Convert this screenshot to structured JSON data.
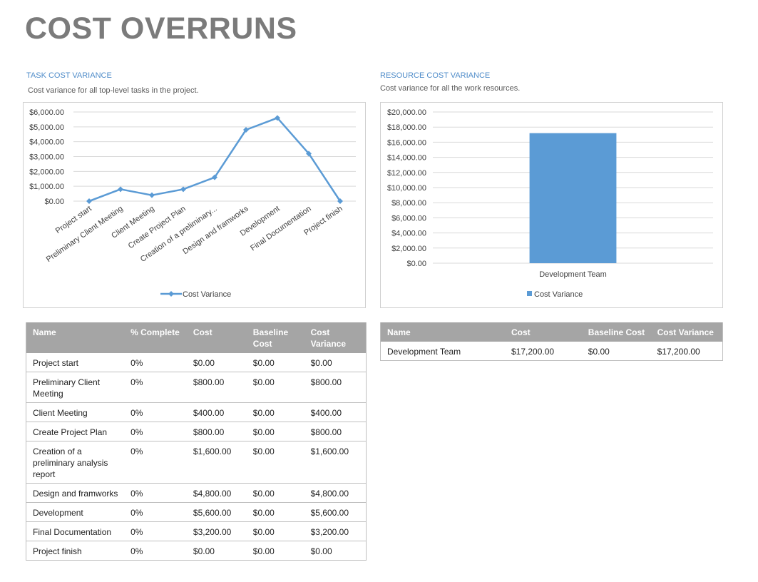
{
  "page": {
    "title": "COST OVERRUNS"
  },
  "task_section": {
    "title": "TASK COST VARIANCE",
    "subtitle": "Cost variance for all top-level tasks in the project."
  },
  "resource_section": {
    "title": "RESOURCE COST VARIANCE",
    "subtitle": "Cost variance for all the work resources."
  },
  "chart_data": [
    {
      "type": "line",
      "categories": [
        "Project start",
        "Preliminary Client Meeting",
        "Client Meeting",
        "Create Project Plan",
        "Creation of a preliminary...",
        "Design and framworks",
        "Development",
        "Final Documentation",
        "Project finish"
      ],
      "series": [
        {
          "name": "Cost Variance",
          "values": [
            0,
            800,
            400,
            800,
            1600,
            4800,
            5600,
            3200,
            0
          ],
          "color": "#5b9bd5"
        }
      ],
      "yticks": [
        "$0.00",
        "$1,000.00",
        "$2,000.00",
        "$3,000.00",
        "$4,000.00",
        "$5,000.00",
        "$6,000.00"
      ],
      "ylim": [
        0,
        6000
      ],
      "grid": true,
      "legend": "bottom"
    },
    {
      "type": "bar",
      "categories": [
        "Development Team"
      ],
      "series": [
        {
          "name": "Cost Variance",
          "values": [
            17200
          ],
          "color": "#5b9bd5"
        }
      ],
      "yticks": [
        "$0.00",
        "$2,000.00",
        "$4,000.00",
        "$6,000.00",
        "$8,000.00",
        "$10,000.00",
        "$12,000.00",
        "$14,000.00",
        "$16,000.00",
        "$18,000.00",
        "$20,000.00"
      ],
      "ylim": [
        0,
        20000
      ],
      "grid": true,
      "legend": "bottom"
    }
  ],
  "task_table": {
    "headers": [
      "Name",
      "% Complete",
      "Cost",
      "Baseline Cost",
      "Cost Variance"
    ],
    "rows": [
      [
        "Project start",
        "0%",
        "$0.00",
        "$0.00",
        "$0.00"
      ],
      [
        "Preliminary Client Meeting",
        "0%",
        "$800.00",
        "$0.00",
        "$800.00"
      ],
      [
        "Client Meeting",
        "0%",
        "$400.00",
        "$0.00",
        "$400.00"
      ],
      [
        "Create Project Plan",
        "0%",
        "$800.00",
        "$0.00",
        "$800.00"
      ],
      [
        "Creation of a preliminary analysis report",
        "0%",
        "$1,600.00",
        "$0.00",
        "$1,600.00"
      ],
      [
        "Design and framworks",
        "0%",
        "$4,800.00",
        "$0.00",
        "$4,800.00"
      ],
      [
        "Development",
        "0%",
        "$5,600.00",
        "$0.00",
        "$5,600.00"
      ],
      [
        "Final Documentation",
        "0%",
        "$3,200.00",
        "$0.00",
        "$3,200.00"
      ],
      [
        "Project finish",
        "0%",
        "$0.00",
        "$0.00",
        "$0.00"
      ]
    ]
  },
  "resource_table": {
    "headers": [
      "Name",
      "Cost",
      "Baseline Cost",
      "Cost Variance"
    ],
    "rows": [
      [
        "Development Team",
        "$17,200.00",
        "$0.00",
        "$17,200.00"
      ]
    ]
  }
}
